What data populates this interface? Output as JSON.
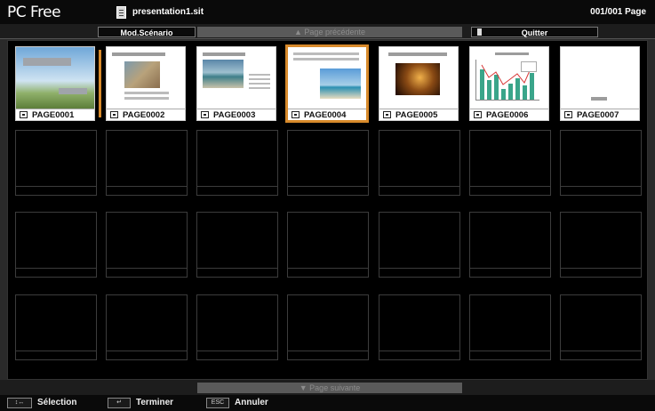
{
  "app": {
    "title": "PC Free",
    "file_name": "presentation1.sit",
    "page_count": "001/001 Page"
  },
  "toolbar": {
    "mode_label": "Mod.Scénario",
    "prev_label": "▲ Page précédente",
    "quit_label": "Quitter"
  },
  "slides": [
    {
      "label": "PAGE0001",
      "icon": "slide-icon",
      "selected": false
    },
    {
      "label": "PAGE0002",
      "icon": "slide-icon",
      "selected": false
    },
    {
      "label": "PAGE0003",
      "icon": "slide-icon",
      "selected": false
    },
    {
      "label": "PAGE0004",
      "icon": "slide-icon",
      "selected": true
    },
    {
      "label": "PAGE0005",
      "icon": "slide-icon",
      "selected": false
    },
    {
      "label": "PAGE0006",
      "icon": "slide-icon",
      "selected": false
    },
    {
      "label": "PAGE0007",
      "icon": "slide-icon",
      "selected": false
    }
  ],
  "footer": {
    "next_label": "▼ Page suivante",
    "help": [
      {
        "key": "↕↔",
        "label": "Sélection"
      },
      {
        "key": "↵",
        "label": "Terminer"
      },
      {
        "key": "ESC",
        "label": "Annuler"
      }
    ]
  },
  "colors": {
    "selection": "#d88a2b",
    "background": "#000000",
    "bar": "#1d1d1d"
  }
}
